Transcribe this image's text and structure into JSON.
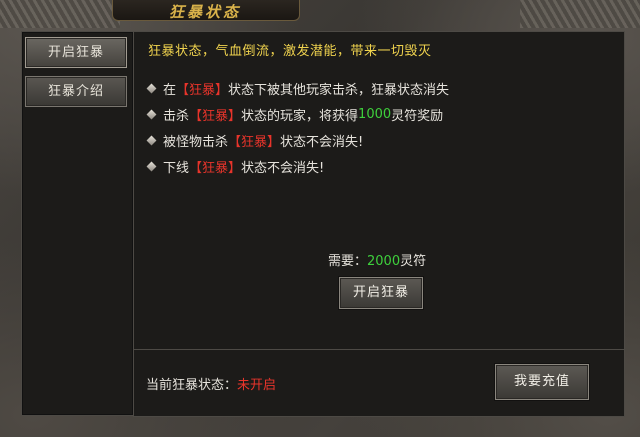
{
  "window": {
    "title": "狂暴状态"
  },
  "sidebar": {
    "items": [
      {
        "label": "开启狂暴",
        "active": true
      },
      {
        "label": "狂暴介绍",
        "active": false
      }
    ]
  },
  "main": {
    "headline": "狂暴状态，气血倒流，激发潜能，带来一切毁灭",
    "rules": [
      {
        "pre": "在",
        "tag": "【狂暴】",
        "mid": "状态下被其他玩家击杀，狂暴状态消失",
        "num": "",
        "post": ""
      },
      {
        "pre": "击杀",
        "tag": "【狂暴】",
        "mid": "状态的玩家，将获得",
        "num": "1000",
        "post": "灵符奖励"
      },
      {
        "pre": "被怪物击杀",
        "tag": "【狂暴】",
        "mid": "状态不会消失!",
        "num": "",
        "post": ""
      },
      {
        "pre": "下线",
        "tag": "【狂暴】",
        "mid": "状态不会消失!",
        "num": "",
        "post": ""
      }
    ],
    "cost": {
      "label": "需要：",
      "amount": "2000",
      "unit": "灵符"
    },
    "activate_button": "开启狂暴"
  },
  "status": {
    "label": "当前狂暴状态：",
    "value": "未开启"
  },
  "recharge_button": "我要充值",
  "colors": {
    "headline": "#f0d34e",
    "tag": "#e8342b",
    "number": "#3ed03c",
    "title": "#d9b24a"
  }
}
